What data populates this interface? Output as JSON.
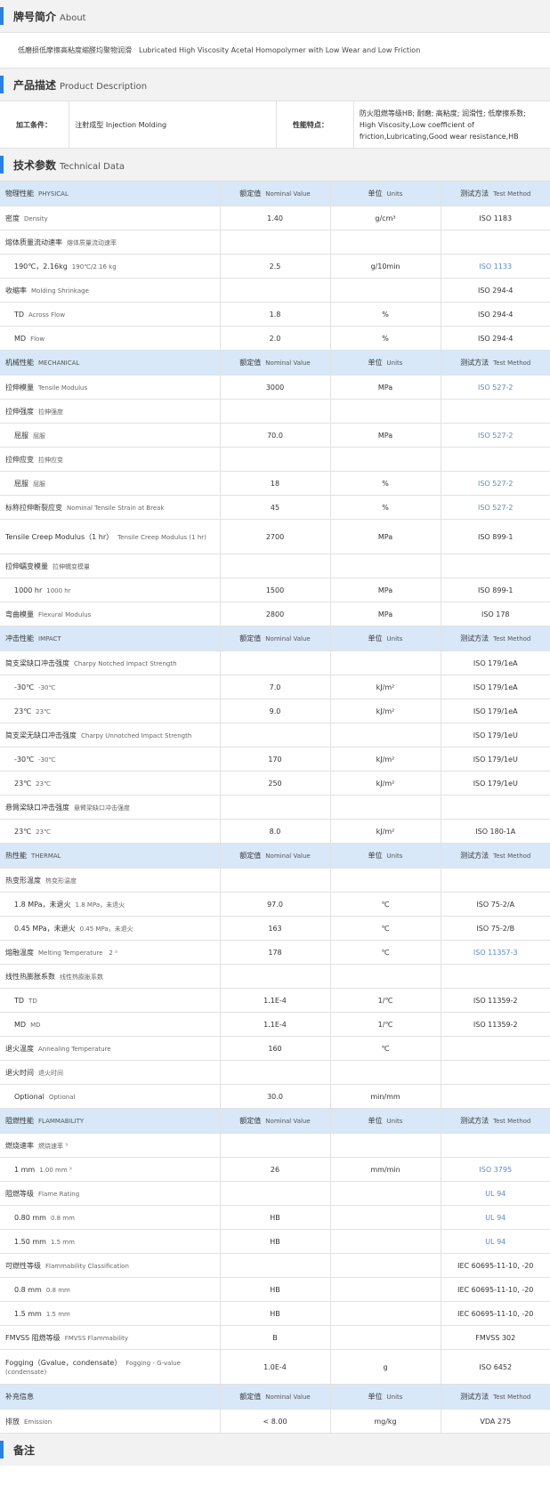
{
  "about": {
    "title": "牌号简介",
    "title_en": "About",
    "text": "低磨损低摩擦高粘度缩醛均聚物润滑",
    "text_en": "Lubricated High Viscosity Acetal Homopolymer with Low Wear and Low Friction"
  },
  "description": {
    "title": "产品描述",
    "title_en": "Product Description",
    "process_label": "加工条件：",
    "process_value": "注射成型 Injection Molding",
    "features_label": "性能特点：",
    "features_value_line1": "防火阻燃等级HB; 耐磨; 高粘度; 润滑性; 低摩擦系数;",
    "features_value_line2": "High Viscosity,Low coefficient of friction,Lubricating,Good wear resistance,HB"
  },
  "technical": {
    "title": "技术参数",
    "title_en": "Technical Data",
    "header": {
      "nominal": "额定值",
      "nominal_en": "Nominal Value",
      "units": "单位",
      "units_en": "Units",
      "method": "测试方法",
      "method_en": "Test Method"
    },
    "rows": [
      {
        "type": "group",
        "name": "物理性能",
        "sub": "PHYSICAL"
      },
      {
        "name": "密度",
        "sub": "Density",
        "value": "1.40",
        "unit": "g/cm³",
        "method": "ISO 1183"
      },
      {
        "name": "熔体质量流动速率",
        "sub": "熔体质量流动速率",
        "value": "",
        "unit": "",
        "method": ""
      },
      {
        "name": "190℃，2.16kg",
        "sub": "190℃/2.16 kg",
        "indent": true,
        "value": "2.5",
        "unit": "g/10min",
        "method": "ISO 1133",
        "link": true
      },
      {
        "name": "收缩率",
        "sub": "Molding Shrinkage",
        "value": "",
        "unit": "",
        "method": "ISO 294-4"
      },
      {
        "name": "TD",
        "sub": "Across Flow",
        "indent": true,
        "value": "1.8",
        "unit": "%",
        "method": "ISO 294-4"
      },
      {
        "name": "MD",
        "sub": "Flow",
        "indent": true,
        "value": "2.0",
        "unit": "%",
        "method": "ISO 294-4"
      },
      {
        "type": "group",
        "name": "机械性能",
        "sub": "MECHANICAL"
      },
      {
        "name": "拉伸模量",
        "sub": "Tensile Modulus",
        "value": "3000",
        "unit": "MPa",
        "method": "ISO 527-2",
        "link": true
      },
      {
        "name": "拉伸强度",
        "sub": "拉伸强度",
        "value": "",
        "unit": "",
        "method": ""
      },
      {
        "name": "屈服",
        "sub": "屈服",
        "indent": true,
        "value": "70.0",
        "unit": "MPa",
        "method": "ISO 527-2",
        "link": true
      },
      {
        "name": "拉伸应变",
        "sub": "拉伸应变",
        "value": "",
        "unit": "",
        "method": ""
      },
      {
        "name": "屈服",
        "sub": "屈服",
        "indent": true,
        "value": "18",
        "unit": "%",
        "method": "ISO 527-2",
        "link": true
      },
      {
        "name": "标称拉伸断裂应变",
        "sub": "Nominal Tensile Strain at Break",
        "value": "45",
        "unit": "%",
        "method": "ISO 527-2",
        "link": true
      },
      {
        "name": "Tensile Creep Modulus（1 hr）",
        "sub": "Tensile Creep Modulus (1 hr)",
        "value": "2700",
        "unit": "MPa",
        "method": "ISO 899-1",
        "tall": true
      },
      {
        "name": "拉伸蠕变模量",
        "sub": "拉伸蠕变模量",
        "value": "",
        "unit": "",
        "method": ""
      },
      {
        "name": "1000 hr",
        "sub": "1000 hr",
        "indent": true,
        "value": "1500",
        "unit": "MPa",
        "method": "ISO 899-1"
      },
      {
        "name": "弯曲模量",
        "sub": "Flexural Modulus",
        "value": "2800",
        "unit": "MPa",
        "method": "ISO 178"
      },
      {
        "type": "group",
        "name": "冲击性能",
        "sub": "IMPACT"
      },
      {
        "name": "简支梁缺口冲击强度",
        "sub": "Charpy Notched Impact Strength",
        "value": "",
        "unit": "",
        "method": "ISO 179/1eA"
      },
      {
        "name": "-30℃",
        "sub": "-30℃",
        "indent": true,
        "value": "7.0",
        "unit": "kJ/m²",
        "method": "ISO 179/1eA"
      },
      {
        "name": "23℃",
        "sub": "23℃",
        "indent": true,
        "value": "9.0",
        "unit": "kJ/m²",
        "method": "ISO 179/1eA"
      },
      {
        "name": "简支梁无缺口冲击强度",
        "sub": "Charpy Unnotched Impact Strength",
        "value": "",
        "unit": "",
        "method": "ISO 179/1eU"
      },
      {
        "name": "-30℃",
        "sub": "-30℃",
        "indent": true,
        "value": "170",
        "unit": "kJ/m²",
        "method": "ISO 179/1eU"
      },
      {
        "name": "23℃",
        "sub": "23℃",
        "indent": true,
        "value": "250",
        "unit": "kJ/m²",
        "method": "ISO 179/1eU"
      },
      {
        "name": "悬臂梁缺口冲击强度",
        "sub": "悬臂梁缺口冲击强度",
        "value": "",
        "unit": "",
        "method": ""
      },
      {
        "name": "23℃",
        "sub": "23℃",
        "indent": true,
        "value": "8.0",
        "unit": "kJ/m²",
        "method": "ISO 180-1A"
      },
      {
        "type": "group",
        "name": "热性能",
        "sub": "THERMAL"
      },
      {
        "name": "热变形温度",
        "sub": "热变形温度",
        "value": "",
        "unit": "",
        "method": ""
      },
      {
        "name": "1.8 MPa，未退火",
        "sub": "1.8 MPa，未退火",
        "indent": true,
        "value": "97.0",
        "unit": "℃",
        "method": "ISO 75-2/A"
      },
      {
        "name": "0.45 MPa，未退火",
        "sub": "0.45 MPa，未退火",
        "indent": true,
        "value": "163",
        "unit": "℃",
        "method": "ISO 75-2/B"
      },
      {
        "name": "熔融温度",
        "sub": "Melting Temperature　2 ²",
        "value": "178",
        "unit": "℃",
        "method": "ISO 11357-3",
        "link": true
      },
      {
        "name": "线性热膨胀系数",
        "sub": "线性热膨胀系数",
        "value": "",
        "unit": "",
        "method": ""
      },
      {
        "name": "TD",
        "sub": "TD",
        "indent": true,
        "value": "1.1E-4",
        "unit": "1/℃",
        "method": "ISO 11359-2"
      },
      {
        "name": "MD",
        "sub": "MD",
        "indent": true,
        "value": "1.1E-4",
        "unit": "1/℃",
        "method": "ISO 11359-2"
      },
      {
        "name": "退火温度",
        "sub": "Annealing Temperature",
        "value": "160",
        "unit": "℃",
        "method": ""
      },
      {
        "name": "退火时间",
        "sub": "退火时间",
        "value": "",
        "unit": "",
        "method": ""
      },
      {
        "name": "Optional",
        "sub": "Optional",
        "indent": true,
        "value": "30.0",
        "unit": "min/mm",
        "method": ""
      },
      {
        "type": "group",
        "name": "阻燃性能",
        "sub": "FLAMMABILITY"
      },
      {
        "name": "燃烧速率",
        "sub": "燃烧速率 ³",
        "value": "",
        "unit": "",
        "method": ""
      },
      {
        "name": "1 mm",
        "sub": "1.00 mm ³",
        "indent": true,
        "value": "26",
        "unit": "mm/min",
        "method": "ISO 3795",
        "link": true
      },
      {
        "name": "阻燃等级",
        "sub": "Flame Rating",
        "value": "",
        "unit": "",
        "method": "UL 94",
        "link": true
      },
      {
        "name": "0.80 mm",
        "sub": "0.8 mm",
        "indent": true,
        "value": "HB",
        "unit": "",
        "method": "UL 94",
        "link": true
      },
      {
        "name": "1.50 mm",
        "sub": "1.5 mm",
        "indent": true,
        "value": "HB",
        "unit": "",
        "method": "UL 94",
        "link": true
      },
      {
        "name": "可燃性等级",
        "sub": "Flammability Classification",
        "value": "",
        "unit": "",
        "method": "IEC 60695-11-10, -20"
      },
      {
        "name": "0.8 mm",
        "sub": "0.8 mm",
        "indent": true,
        "value": "HB",
        "unit": "",
        "method": "IEC 60695-11-10, -20"
      },
      {
        "name": "1.5 mm",
        "sub": "1.5 mm",
        "indent": true,
        "value": "HB",
        "unit": "",
        "method": "IEC 60695-11-10, -20"
      },
      {
        "name": "FMVSS 阻燃等级",
        "sub": "FMVSS Flammability",
        "value": "B",
        "unit": "",
        "method": "FMVSS 302"
      },
      {
        "name": "Fogging（Gvalue，condensate）",
        "sub": "Fogging - G-value (condensate)",
        "value": "1.0E-4",
        "unit": "g",
        "method": "ISO 6452",
        "tall": true
      },
      {
        "type": "group",
        "name": "补充信息",
        "sub": ""
      },
      {
        "name": "排放",
        "sub": "Emission",
        "value": "< 8.00",
        "unit": "mg/kg",
        "method": "VDA 275"
      }
    ]
  },
  "notes": {
    "title": "备注"
  }
}
